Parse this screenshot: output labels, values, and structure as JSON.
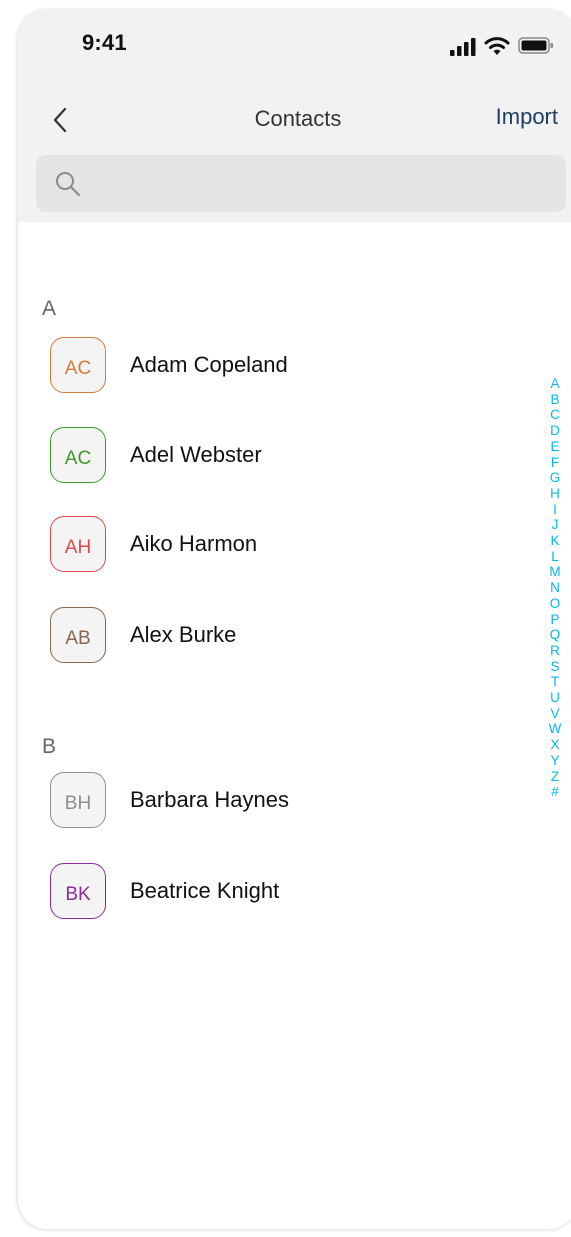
{
  "status_bar": {
    "time": "9:41"
  },
  "nav": {
    "title": "Contacts",
    "action": "Import"
  },
  "search": {
    "placeholder": "",
    "value": ""
  },
  "sections": [
    {
      "letter": "A",
      "contacts": [
        {
          "initials": "AC",
          "name": "Adam Copeland",
          "color": "#d27a3a"
        },
        {
          "initials": "AC",
          "name": "Adel Webster",
          "color": "#3c9a2c"
        },
        {
          "initials": "AH",
          "name": "Aiko Harmon",
          "color": "#e04848"
        },
        {
          "initials": "AB",
          "name": "Alex Burke",
          "color": "#8a6650"
        }
      ]
    },
    {
      "letter": "B",
      "contacts": [
        {
          "initials": "BH",
          "name": "Barbara Haynes",
          "color": "#8e8e8e"
        },
        {
          "initials": "BK",
          "name": "Beatrice Knight",
          "color": "#8a2d9a"
        }
      ]
    }
  ],
  "alphabet_index": [
    "A",
    "B",
    "C",
    "D",
    "E",
    "F",
    "G",
    "H",
    "I",
    "J",
    "K",
    "L",
    "M",
    "N",
    "O",
    "P",
    "Q",
    "R",
    "S",
    "T",
    "U",
    "V",
    "W",
    "X",
    "Y",
    "Z",
    "#"
  ],
  "colors": {
    "accent": "#00b8ef",
    "import_link": "#1f3d63",
    "header_bg": "#f2f2f3"
  }
}
